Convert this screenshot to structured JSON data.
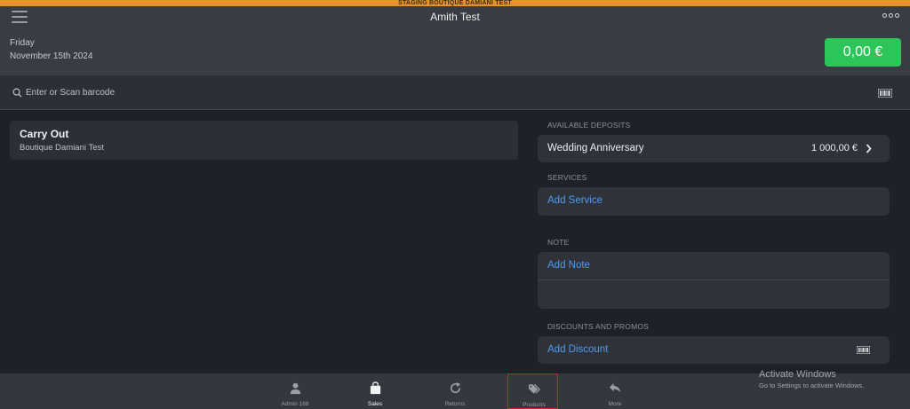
{
  "staging_banner": "STAGING BOUTIQUE DAMIANI TEST",
  "header": {
    "title": "Amith Test",
    "day": "Friday",
    "date": "November 15th 2024",
    "total": "0,00 €"
  },
  "search": {
    "placeholder": "Enter or Scan barcode"
  },
  "order": {
    "type": "Carry Out",
    "store": "Boutique Damiani Test"
  },
  "deposits": {
    "label": "AVAILABLE DEPOSITS",
    "name": "Wedding Anniversary",
    "amount": "1 000,00 €"
  },
  "services": {
    "label": "SERVICES",
    "action": "Add Service"
  },
  "note": {
    "label": "NOTE",
    "action": "Add Note"
  },
  "discounts": {
    "label": "DISCOUNTS AND PROMOS",
    "action": "Add Discount"
  },
  "nav": [
    {
      "label": "Admin 168",
      "icon": "user-icon"
    },
    {
      "label": "Sales",
      "icon": "shopping-bag-icon"
    },
    {
      "label": "Returns",
      "icon": "refresh-icon"
    },
    {
      "label": "Products",
      "icon": "tags-icon"
    },
    {
      "label": "More",
      "icon": "reply-icon"
    }
  ],
  "watermark": {
    "line1": "Activate Windows",
    "line2": "Go to Settings to activate Windows."
  },
  "colors": {
    "accent_green": "#2cc55a",
    "link_blue": "#4d9cf0",
    "staging_orange": "#e8932a",
    "highlight_red": "#d0242c"
  }
}
